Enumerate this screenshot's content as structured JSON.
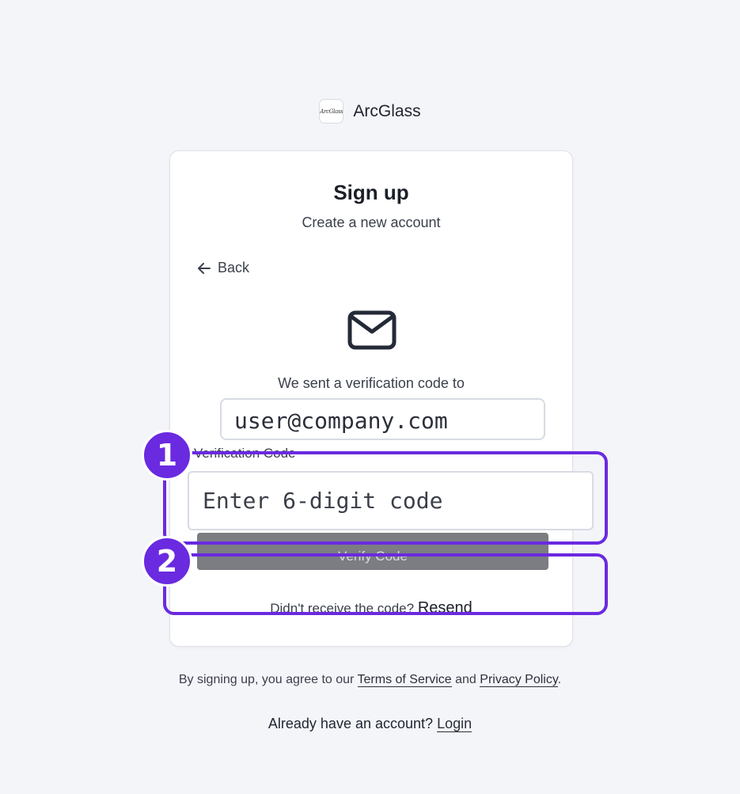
{
  "brand": {
    "name": "ArcGlass",
    "logo_text": "ArcGlass"
  },
  "card": {
    "title": "Sign up",
    "subtitle": "Create a new account",
    "back_label": "Back",
    "sent_text": "We sent a verification code to",
    "email": "user@company.com",
    "code_label": "Verification Code",
    "code_placeholder": "Enter 6-digit code",
    "verify_label": "Verify Code",
    "resend_prompt": "Didn't receive the code?",
    "resend_label": "Resend"
  },
  "footer": {
    "terms_prefix": "By signing up, you agree to our",
    "terms_link": "Terms of Service",
    "terms_and": "and",
    "privacy_link": "Privacy Policy",
    "terms_suffix": ".",
    "login_prompt": "Already have an account?",
    "login_link": "Login"
  },
  "annotations": [
    {
      "label": "1"
    },
    {
      "label": "2"
    }
  ],
  "colors": {
    "highlight": "#6a2ae0",
    "button_disabled": "#7b7d83",
    "background": "#f4f5f9"
  }
}
